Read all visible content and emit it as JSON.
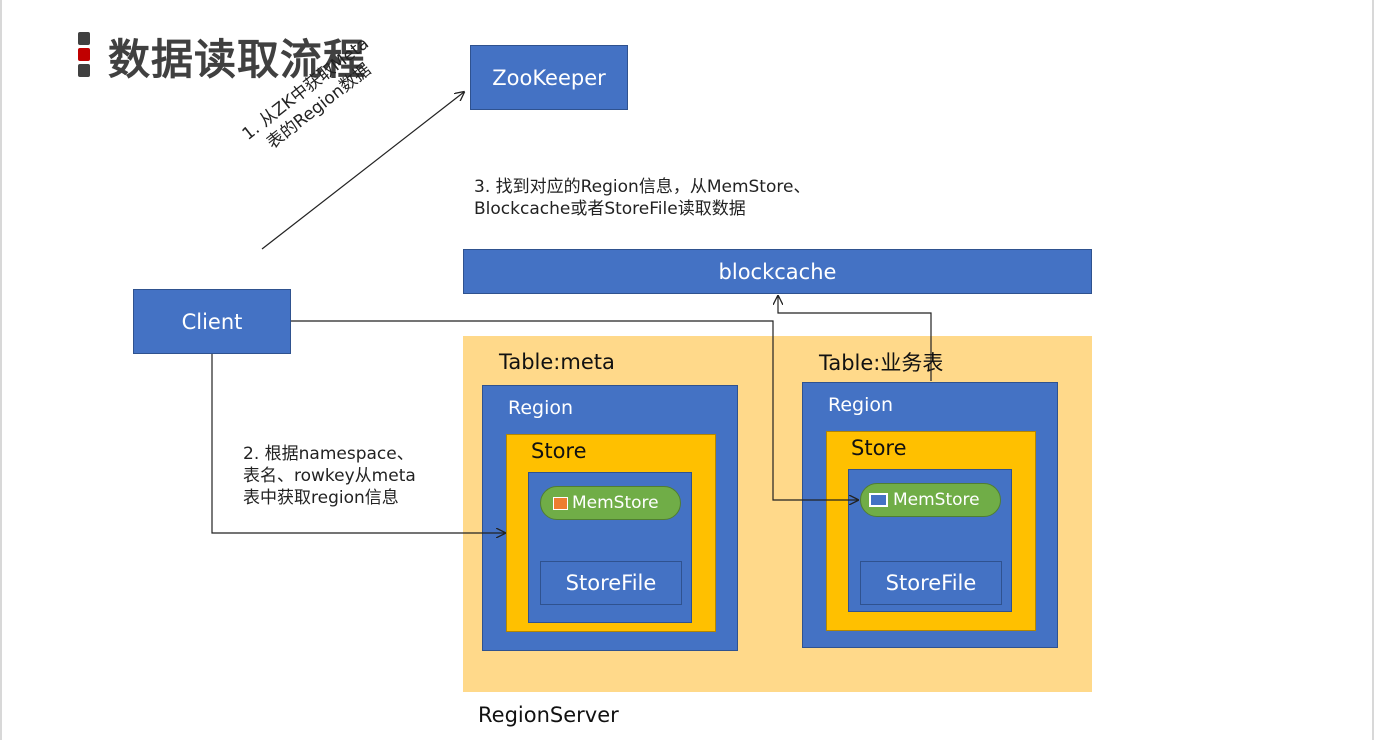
{
  "title": "数据读取流程",
  "nodes": {
    "zookeeper": "ZooKeeper",
    "client": "Client",
    "blockcache": "blockcache",
    "region_server": "RegionServer",
    "table_meta": "Table:meta",
    "table_business": "Table:业务表",
    "region": "Region",
    "store": "Store",
    "memstore": "MemStore",
    "storefile": "StoreFile"
  },
  "steps": {
    "step1_line1": "1. 从ZK中获取Meta",
    "step1_line2": "表的Region数据",
    "step2_line1": "2. 根据namespace、",
    "step2_line2": "表名、rowkey从meta",
    "step2_line3": "表中获取region信息",
    "step3_line1": "3. 找到对应的Region信息，从MemStore、",
    "step3_line2": "Blockcache或者StoreFile读取数据"
  },
  "colors": {
    "box_blue": "#4472c4",
    "store_yellow": "#ffc000",
    "region_server_bg": "#ffd98a",
    "memstore_green": "#70ad47",
    "title_gray": "#404040",
    "accent_red": "#c00000"
  }
}
